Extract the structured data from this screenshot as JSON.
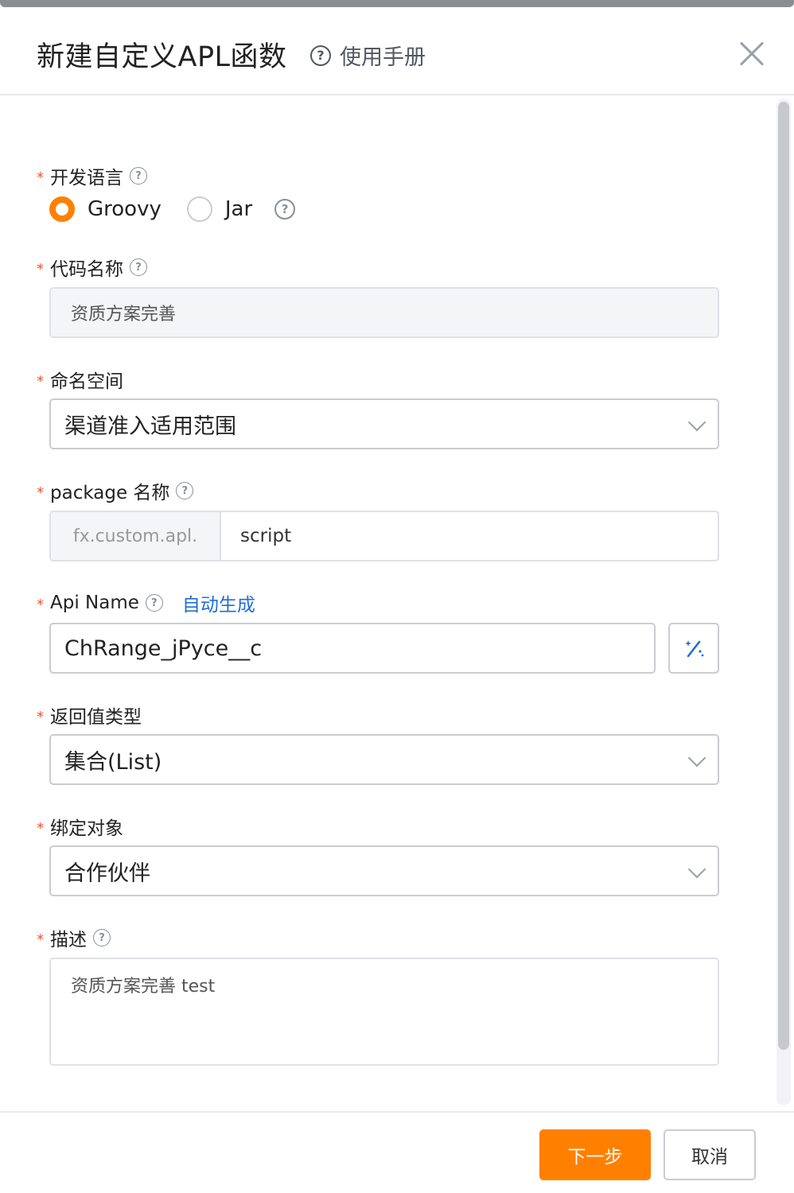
{
  "dialog": {
    "title": "新建自定义APL函数",
    "manual_link": "使用手册"
  },
  "form": {
    "language": {
      "label": "开发语言",
      "options": [
        "Groovy",
        "Jar"
      ],
      "selected": "Groovy"
    },
    "code_name": {
      "label": "代码名称",
      "value": "资质方案完善"
    },
    "namespace": {
      "label": "命名空间",
      "value": "渠道准入适用范围"
    },
    "package": {
      "label": "package 名称",
      "prefix": "fx.custom.apl.",
      "value": "script"
    },
    "api_name": {
      "label": "Api Name",
      "auto_generate": "自动生成",
      "value": "ChRange_jPyce__c"
    },
    "return_type": {
      "label": "返回值类型",
      "value": "集合(List)"
    },
    "bind_object": {
      "label": "绑定对象",
      "value": "合作伙伴"
    },
    "description": {
      "label": "描述",
      "value": "资质方案完善 test"
    },
    "required_mark": "*"
  },
  "footer": {
    "next_label": "下一步",
    "cancel_label": "取消"
  },
  "colors": {
    "accent": "#ff8000",
    "link": "#1f6ed4",
    "required": "#ff522a"
  },
  "icons": [
    "help-circle-icon",
    "close-icon",
    "chevron-down-icon",
    "magic-wand-icon"
  ]
}
